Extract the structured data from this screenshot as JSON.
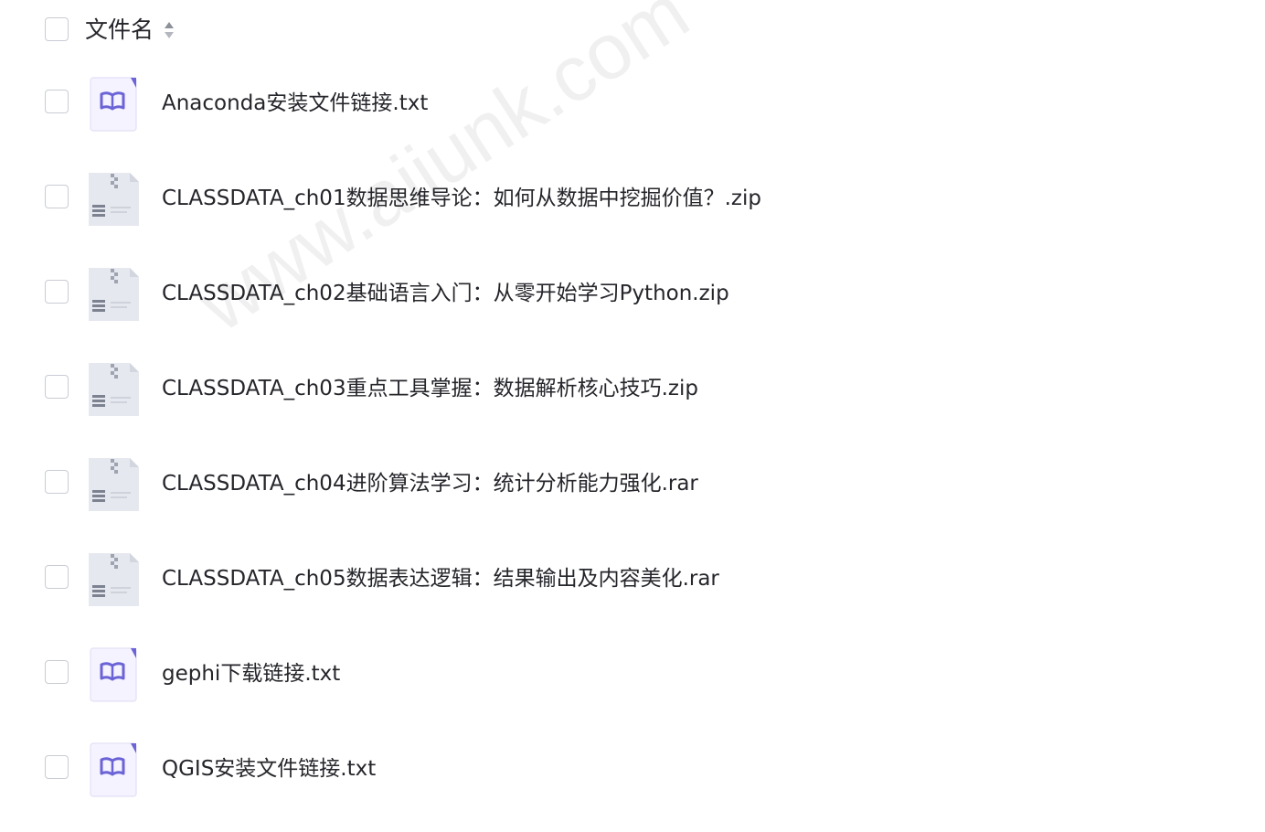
{
  "header": {
    "column_label": "文件名",
    "sort_icon": "sort-icon"
  },
  "files": [
    {
      "name": "Anaconda安装文件链接.txt",
      "icon": "txt-file-icon"
    },
    {
      "name": "CLASSDATA_ch01数据思维导论：如何从数据中挖掘价值？.zip",
      "icon": "archive-file-icon"
    },
    {
      "name": "CLASSDATA_ch02基础语言入门：从零开始学习Python.zip",
      "icon": "archive-file-icon"
    },
    {
      "name": "CLASSDATA_ch03重点工具掌握：数据解析核心技巧.zip",
      "icon": "archive-file-icon"
    },
    {
      "name": "CLASSDATA_ch04进阶算法学习：统计分析能力强化.rar",
      "icon": "archive-file-icon"
    },
    {
      "name": "CLASSDATA_ch05数据表达逻辑：结果输出及内容美化.rar",
      "icon": "archive-file-icon"
    },
    {
      "name": "gephi下载链接.txt",
      "icon": "txt-file-icon"
    },
    {
      "name": "QGIS安装文件链接.txt",
      "icon": "txt-file-icon"
    }
  ],
  "watermark": "www.aiiunk.com",
  "colors": {
    "txt_icon_accent": "#6b63d6",
    "txt_icon_bg": "#f4f3ff",
    "archive_icon_bg": "#e6e8ef",
    "checkbox_border": "#c9ccd4",
    "text": "#25262b"
  }
}
